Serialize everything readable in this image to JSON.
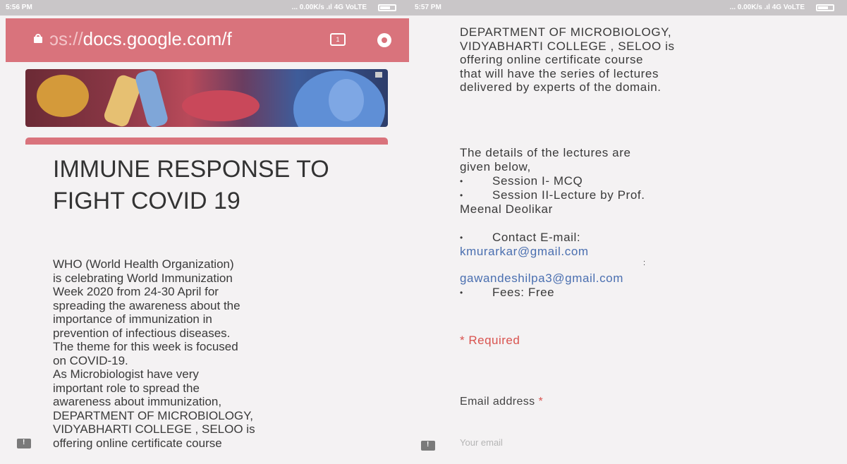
{
  "status_left": {
    "time": "5:56 PM",
    "network": "... 0.00K/s  .ıl 4G VoLTE"
  },
  "status_right": {
    "time": "5:57 PM",
    "network": "... 0.00K/s  .ıl 4G VoLTE"
  },
  "browser": {
    "url_faint": "ɔs://",
    "url": "docs.google.com/f",
    "tab_count": "1"
  },
  "form": {
    "title": "IMMUNE RESPONSE TO FIGHT COVID 19",
    "description_left": [
      "WHO (World Health Organization)",
      "is celebrating World Immunization",
      "Week 2020 from 24-30 April for",
      "spreading the awareness about the",
      "importance of immunization in",
      "prevention of infectious diseases.",
      "The theme for this week is focused",
      "on COVID-19.",
      "As Microbiologist have very",
      "important role to spread the",
      "awareness about immunization,",
      "DEPARTMENT OF MICROBIOLOGY,",
      "VIDYABHARTI COLLEGE , SELOO is",
      "offering online certificate course"
    ],
    "description_right": [
      "DEPARTMENT OF MICROBIOLOGY,",
      "VIDYABHARTI COLLEGE , SELOO is",
      "offering online certificate course",
      "that will have the series of lectures",
      "delivered by experts of the domain."
    ],
    "details_intro": [
      "The details of the lectures are",
      "given below,"
    ],
    "session1": "Session I- MCQ",
    "session2": "Session II-Lecture by Prof.",
    "session2_cont": "Meenal Deolikar",
    "contact": "Contact E-mail:",
    "email1": "kmurarkar@gmail.com",
    "separator": ":",
    "email2": "gawandeshilpa3@gmail.com",
    "fees": "Fees: Free",
    "required_note": "* Required",
    "email_label": "Email address",
    "required_star": "*",
    "email_placeholder": "Your email"
  },
  "icons": {
    "lock": "lock-icon",
    "tabs": "tabs-icon",
    "download": "download-icon",
    "feedback": "feedback-icon"
  },
  "colors": {
    "accent": "#d9737c",
    "link": "#4a6fb0",
    "required": "#d9534f"
  }
}
